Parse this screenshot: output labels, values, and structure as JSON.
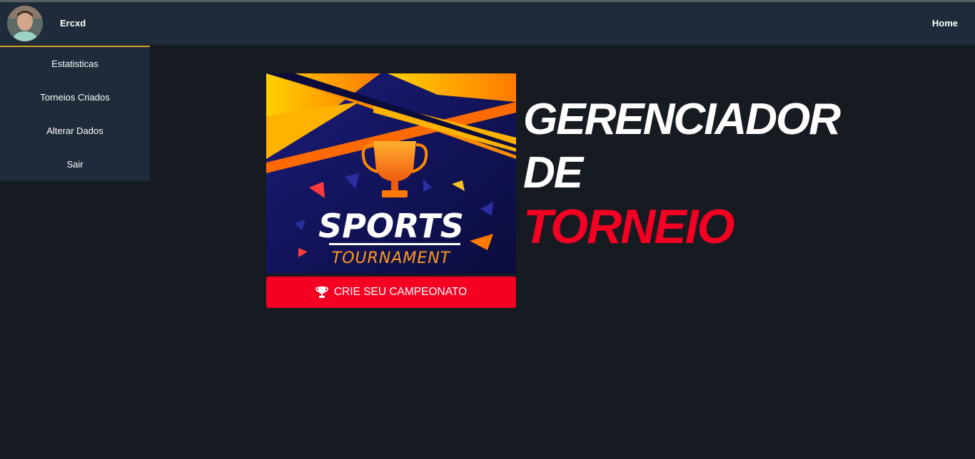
{
  "navbar": {
    "username": "Ercxd",
    "home_label": "Home"
  },
  "sidebar": {
    "items": [
      {
        "label": "Estatisticas"
      },
      {
        "label": "Torneios Criados"
      },
      {
        "label": "Alterar Dados"
      },
      {
        "label": "Sair"
      }
    ]
  },
  "hero": {
    "image_title": "SPORTS",
    "image_subtitle": "TOURNAMENT",
    "cta_label": "CRIE SEU CAMPEONATO",
    "cta_icon": "trophy-icon"
  },
  "heading": {
    "line1": "GERENCIADOR",
    "line2": "DE",
    "line3": "TORNEIO"
  },
  "colors": {
    "background": "#161b22",
    "navbar": "#1f2b3a",
    "accent_red": "#f40022",
    "sidebar_border": "#d9a52b"
  }
}
